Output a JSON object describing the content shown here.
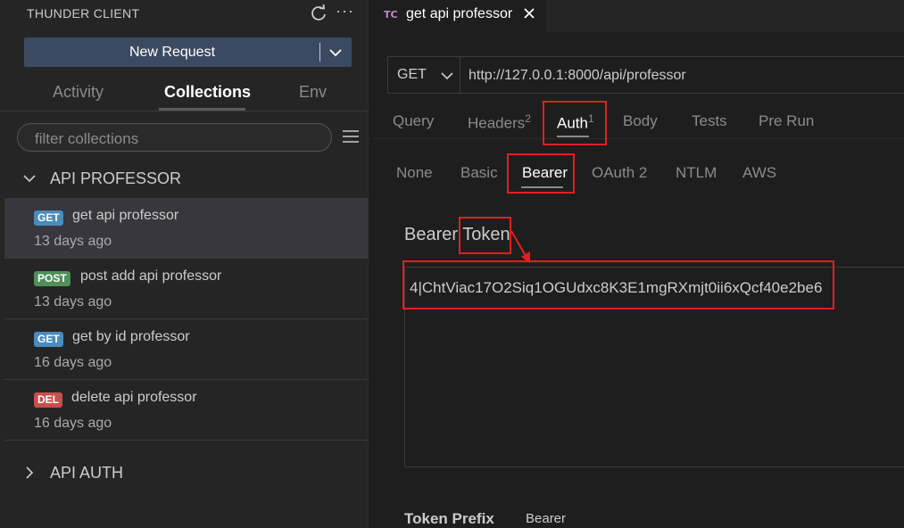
{
  "sidebar": {
    "header": "THUNDER CLIENT",
    "new_request": "New Request",
    "tabs": [
      "Activity",
      "Collections",
      "Env"
    ],
    "filter_placeholder": "filter collections",
    "collections": [
      {
        "name": "API PROFESSOR",
        "requests": [
          {
            "method": "GET",
            "name": "get api professor",
            "time": "13 days ago",
            "color": "#4b8bbe"
          },
          {
            "method": "POST",
            "name": "post add api professor",
            "time": "13 days ago",
            "color": "#4f8f58"
          },
          {
            "method": "GET",
            "name": "get by id professor",
            "time": "16 days ago",
            "color": "#4b8bbe"
          },
          {
            "method": "DEL",
            "name": "delete api professor",
            "time": "16 days ago",
            "color": "#c94f4f"
          }
        ]
      },
      {
        "name": "API AUTH"
      }
    ]
  },
  "main": {
    "tab": {
      "icon": "TC",
      "title": "get api professor"
    },
    "method": "GET",
    "url": "http://127.0.0.1:8000/api/professor",
    "request_tabs": [
      {
        "label": "Query"
      },
      {
        "label": "Headers",
        "count": "2"
      },
      {
        "label": "Auth",
        "count": "1"
      },
      {
        "label": "Body"
      },
      {
        "label": "Tests"
      },
      {
        "label": "Pre Run"
      }
    ],
    "auth_tabs": [
      "None",
      "Basic",
      "Bearer",
      "OAuth 2",
      "NTLM",
      "AWS"
    ],
    "bearer_label_a": "Bearer",
    "bearer_label_b": "Token",
    "token": "4|ChtViac17O2Siq1OGUdxc8K3E1mgRXmjt0ii6xQcf40e2be6",
    "token_prefix_label": "Token Prefix",
    "token_prefix_value": "Bearer"
  },
  "colors": {
    "highlight": "#e02020",
    "accent": "#3c4a61"
  }
}
